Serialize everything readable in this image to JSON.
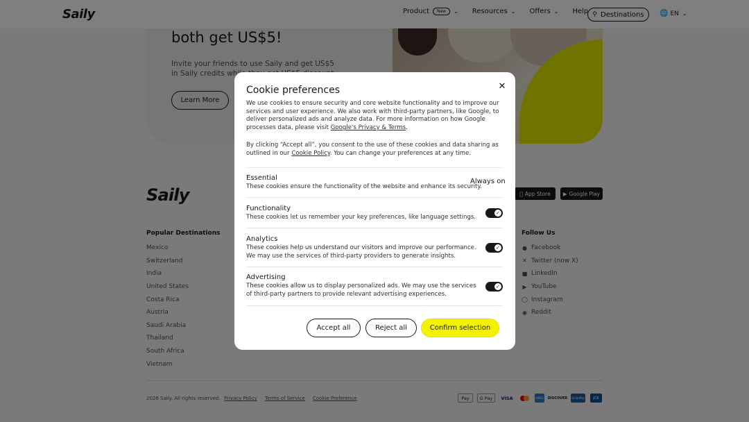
{
  "nav": {
    "logo": "Saily",
    "items": [
      {
        "label": "Product",
        "badge": "New"
      },
      {
        "label": "Resources"
      },
      {
        "label": "Offers"
      },
      {
        "label": "Help"
      }
    ],
    "destinations_label": "Destinations",
    "language": "EN"
  },
  "hero": {
    "title": "both get US$5!",
    "text": "Invite your friends to use Saily and get US$5 in Saily credits while they get US$5 discount.",
    "button": "Learn More"
  },
  "footer": {
    "logo": "Saily",
    "stores": [
      "App Store",
      "Google Play"
    ],
    "popular": {
      "heading": "Popular Destinations",
      "items": [
        "Mexico",
        "Switzerland",
        "India",
        "United States",
        "Costa Rica",
        "Austria",
        "Saudi Arabia",
        "Thailand",
        "South Africa",
        "Vietnam"
      ]
    },
    "follow": {
      "heading": "Follow Us",
      "items": [
        {
          "label": "Facebook",
          "icon": "facebook-icon"
        },
        {
          "label": "Twitter (now X)",
          "icon": "x-icon"
        },
        {
          "label": "LinkedIn",
          "icon": "linkedin-icon"
        },
        {
          "label": "YouTube",
          "icon": "youtube-icon"
        },
        {
          "label": "Instagram",
          "icon": "instagram-icon"
        },
        {
          "label": "Reddit",
          "icon": "reddit-icon"
        }
      ]
    },
    "legal": {
      "copyright": "2026 Saily. All rights reserved.",
      "privacy": "Privacy Policy",
      "terms": "Terms of Service",
      "cookie": "Cookie Preference"
    },
    "payments": [
      "Pay",
      "G Pay",
      "VISA",
      "Mastercard",
      "AMEX",
      "DISCOVER",
      "UnionPay",
      "JCB"
    ]
  },
  "modal": {
    "title": "Cookie preferences",
    "p1_a": "We use cookies to ensure security and core website functionality and to improve our services and user experience. We also work with third-party partners, like Google, to deliver personalized ads and analyze data. For more information on how Google processes data, please visit ",
    "p1_link": "Google's Privacy & Terms",
    "p1_b": ".",
    "p2_a": "By clicking “Accept all”, you consent to the use of these cookies and data sharing as outlined in our ",
    "p2_link": "Cookie Policy",
    "p2_b": ". You can change your preferences at any time.",
    "categories": [
      {
        "name": "Essential",
        "desc": "These cookies ensure the functionality of the website and enhance its security.",
        "status": "Always on"
      },
      {
        "name": "Functionality",
        "desc": "These cookies let us remember your key preferences, like language settings.",
        "enabled": true
      },
      {
        "name": "Analytics",
        "desc": "These cookies help us understand our visitors and improve our performance. We may use the services of third-party providers to generate insights.",
        "enabled": true
      },
      {
        "name": "Advertising",
        "desc": "These cookies allow us to display personalized ads. We may use the services of third-party partners to provide relevant advertising experiences.",
        "enabled": true
      }
    ],
    "buttons": {
      "accept": "Accept all",
      "reject": "Reject all",
      "confirm": "Confirm selection"
    }
  },
  "colors": {
    "accent": "#f5f200",
    "dark": "#16181b"
  }
}
